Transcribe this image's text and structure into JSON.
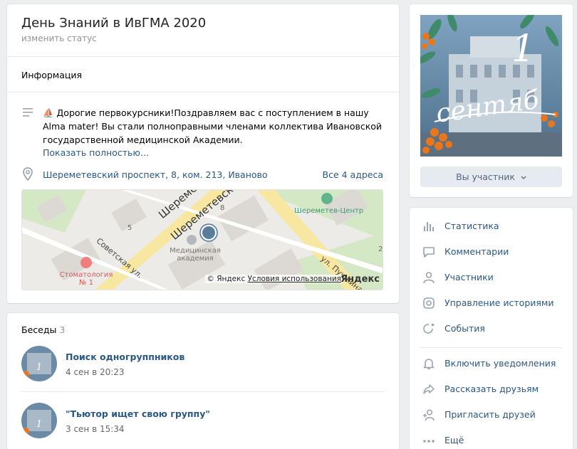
{
  "group": {
    "title": "День Знаний в ИвГМА 2020",
    "status_link": "изменить статус"
  },
  "info": {
    "header": "Информация",
    "description": "⛵ Дорогие первокурсники!Поздравляем вас с поступлением в нашу Alma mater! Вы стали полноправными членами коллектива Ивановской государственной медицинской Академии.",
    "show_more": "Показать полностью…",
    "address": "Шереметевский проспект, 8, ком. 213, Иваново",
    "all_addresses": "Все 4 адреса"
  },
  "map": {
    "labels": {
      "street_1": "Шереметевский",
      "street_2": "Шереметевский",
      "sovetskaya": "Советская ул.",
      "pushkina": "ул. Пушкина",
      "building_8": "8",
      "building_5": "5",
      "building_2": "2",
      "academy": "Медицинская академия",
      "dentistry": "Стоматология № 1",
      "center": "Шереметев-Центр"
    },
    "credit": "© Яндекс",
    "terms": "Условия использования",
    "logo": "Яндекс"
  },
  "chats": {
    "header": "Беседы",
    "count": "3",
    "items": [
      {
        "title": "Поиск одногруппников",
        "time": "4 сен в 20:23"
      },
      {
        "title": "\"Тьютор ищет свою группу\"",
        "time": "3 сен в 15:34"
      }
    ]
  },
  "cover": {
    "member_button": "Вы участник"
  },
  "menu": {
    "items": [
      {
        "label": "Статистика",
        "icon": "stats-icon"
      },
      {
        "label": "Комментарии",
        "icon": "comment-icon"
      },
      {
        "label": "Участники",
        "icon": "user-icon"
      },
      {
        "label": "Управление историями",
        "icon": "stories-icon"
      },
      {
        "label": "События",
        "icon": "events-icon"
      },
      {
        "label": "Включить уведомления",
        "icon": "bell-icon"
      },
      {
        "label": "Рассказать друзьям",
        "icon": "share-icon"
      },
      {
        "label": "Пригласить друзей",
        "icon": "add-user-icon"
      },
      {
        "label": "Ещё",
        "icon": "more-icon"
      }
    ]
  },
  "colors": {
    "accent_link": "#2a5885",
    "button_bg": "#e5ebf1",
    "page_bg": "#edeef0"
  }
}
